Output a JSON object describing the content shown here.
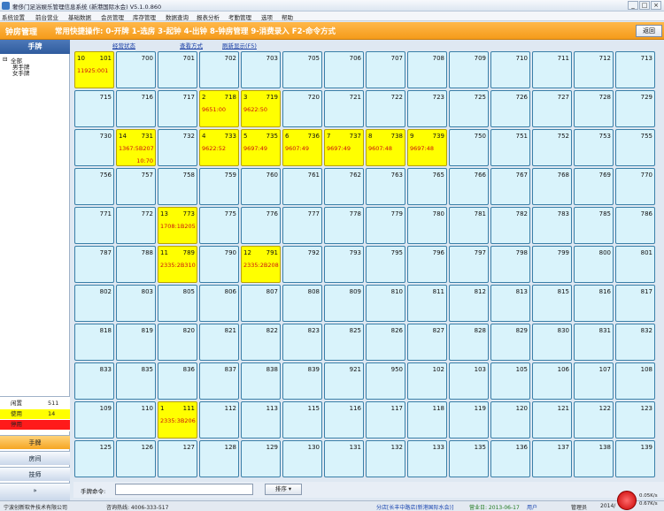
{
  "window": {
    "title": "奢侈门足浴娱乐管理信息系统 (新港国际水会) V5.1.0.860",
    "min": "_",
    "max": "□",
    "close": "×"
  },
  "menu": [
    "系统设置",
    "前台营业",
    "基础数据",
    "会员管理",
    "库存管理",
    "数据查询",
    "报表分析",
    "考勤管理",
    "选项",
    "帮助"
  ],
  "ribbon": {
    "module": "钟房管理",
    "shortcuts": "常用快捷操作: 0-开牌 1-选房 3-起钟 4-出钟 8-钟房管理 9-消费录入 F2-命令方式",
    "return_label": "返回"
  },
  "left": {
    "header": "手牌",
    "tree": {
      "root": "全部",
      "children": [
        "男手牌",
        "女手牌"
      ]
    },
    "stats": [
      {
        "label": "闲置",
        "value": "511",
        "color": "#ffffff"
      },
      {
        "label": "使用",
        "value": "14",
        "color": "#ffff00"
      },
      {
        "label": "停用",
        "value": "",
        "color": "#ff1a1a"
      }
    ],
    "nav": [
      "手牌",
      "房间",
      "技师"
    ]
  },
  "tabs": [
    "经营状态",
    "查看方式",
    "刷新显示(F5)"
  ],
  "rooms": [
    [
      "101",
      "700",
      "701",
      "702",
      "703",
      "705",
      "706",
      "707",
      "708",
      "709",
      "710",
      "711",
      "712",
      "713"
    ],
    [
      "715",
      "716",
      "717",
      "718",
      "719",
      "720",
      "721",
      "722",
      "723",
      "725",
      "726",
      "727",
      "728",
      "729"
    ],
    [
      "730",
      "731",
      "732",
      "733",
      "735",
      "736",
      "737",
      "738",
      "739",
      "750",
      "751",
      "752",
      "753",
      "755"
    ],
    [
      "756",
      "757",
      "758",
      "759",
      "760",
      "761",
      "762",
      "763",
      "765",
      "766",
      "767",
      "768",
      "769",
      "770"
    ],
    [
      "771",
      "772",
      "773",
      "775",
      "776",
      "777",
      "778",
      "779",
      "780",
      "781",
      "782",
      "783",
      "785",
      "786"
    ],
    [
      "787",
      "788",
      "789",
      "790",
      "791",
      "792",
      "793",
      "795",
      "796",
      "797",
      "798",
      "799",
      "800",
      "801"
    ],
    [
      "802",
      "803",
      "805",
      "806",
      "807",
      "808",
      "809",
      "810",
      "811",
      "812",
      "813",
      "815",
      "816",
      "817"
    ],
    [
      "818",
      "819",
      "820",
      "821",
      "822",
      "823",
      "825",
      "826",
      "827",
      "828",
      "829",
      "830",
      "831",
      "832"
    ],
    [
      "833",
      "835",
      "836",
      "837",
      "838",
      "839",
      "921",
      "950",
      "102",
      "103",
      "105",
      "106",
      "107",
      "108"
    ],
    [
      "109",
      "110",
      "111",
      "112",
      "113",
      "115",
      "116",
      "117",
      "118",
      "119",
      "120",
      "121",
      "122",
      "123"
    ],
    [
      "125",
      "126",
      "127",
      "128",
      "129",
      "130",
      "131",
      "132",
      "133",
      "135",
      "136",
      "137",
      "138",
      "139"
    ]
  ],
  "occupied": {
    "101": {
      "hand": "10",
      "time": "11925:001",
      "extra": ""
    },
    "718": {
      "hand": "2",
      "time": "9651:00",
      "extra": ""
    },
    "719": {
      "hand": "3",
      "time": "9622:50",
      "extra": ""
    },
    "731": {
      "hand": "14",
      "time": "1367:5B207",
      "extra": "10:70"
    },
    "733": {
      "hand": "4",
      "time": "9622:52",
      "extra": ""
    },
    "735": {
      "hand": "5",
      "time": "9697:49",
      "extra": ""
    },
    "736": {
      "hand": "6",
      "time": "9607:49",
      "extra": ""
    },
    "737": {
      "hand": "7",
      "time": "9697:49",
      "extra": ""
    },
    "738": {
      "hand": "8",
      "time": "9607:48",
      "extra": ""
    },
    "739": {
      "hand": "9",
      "time": "9697:48",
      "extra": ""
    },
    "773": {
      "hand": "13",
      "time": "1708:1B205",
      "extra": ""
    },
    "789": {
      "hand": "11",
      "time": "2335:2B310",
      "extra": ""
    },
    "791": {
      "hand": "12",
      "time": "2335:2B208",
      "extra": ""
    },
    "111": {
      "hand": "1",
      "time": "2335:3B206",
      "extra": ""
    }
  },
  "command": {
    "label": "手牌命令:",
    "value": "",
    "sort_label": "排序 ▾"
  },
  "status": {
    "company": "宁波创新软件技术有限公司",
    "hotline": "咨询热线: 4006-333-517",
    "store": "分店[长丰中路店(新港国际水会)]",
    "business_date": "营业日: 2013-06-17",
    "user": "用户",
    "role": "管理员",
    "date": "2014/",
    "net_up": "0.05K/s",
    "net_down": "0.67K/s"
  }
}
